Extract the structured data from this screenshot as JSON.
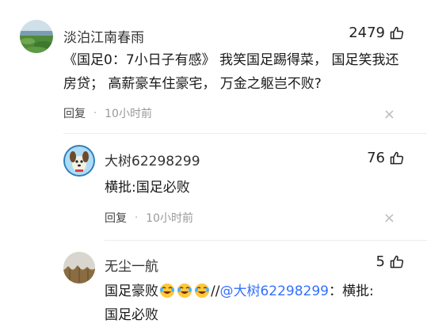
{
  "comments": [
    {
      "username": "淡泊江南春雨",
      "likes": "2479",
      "text": "《国足0：7小日子有感》 我笑国足踢得菜， 国足笑我还房贷； 高薪豪车住豪宅， 万金之躯岂不败?",
      "reply_label": "回复",
      "time": "10小时前",
      "avatar": "landscape-avatar"
    },
    {
      "username": "大树62298299",
      "likes": "76",
      "text": "横批:国足必败",
      "reply_label": "回复",
      "time": "10小时前",
      "avatar": "dog-avatar"
    },
    {
      "username": "无尘一航",
      "likes": "5",
      "text_prefix": "国足豪败",
      "emoji": "laughing-crying-emoji",
      "text_sep": "//",
      "mention": "@大树62298299",
      "text_suffix_1": "：横批:",
      "text_suffix_2": "国足必败",
      "avatar": "field-avatar"
    }
  ],
  "colors": {
    "link": "#3370ff",
    "meta": "#999999",
    "divider": "#ececec"
  },
  "icons": {
    "like": "thumbs-up-icon",
    "close": "close-icon"
  }
}
